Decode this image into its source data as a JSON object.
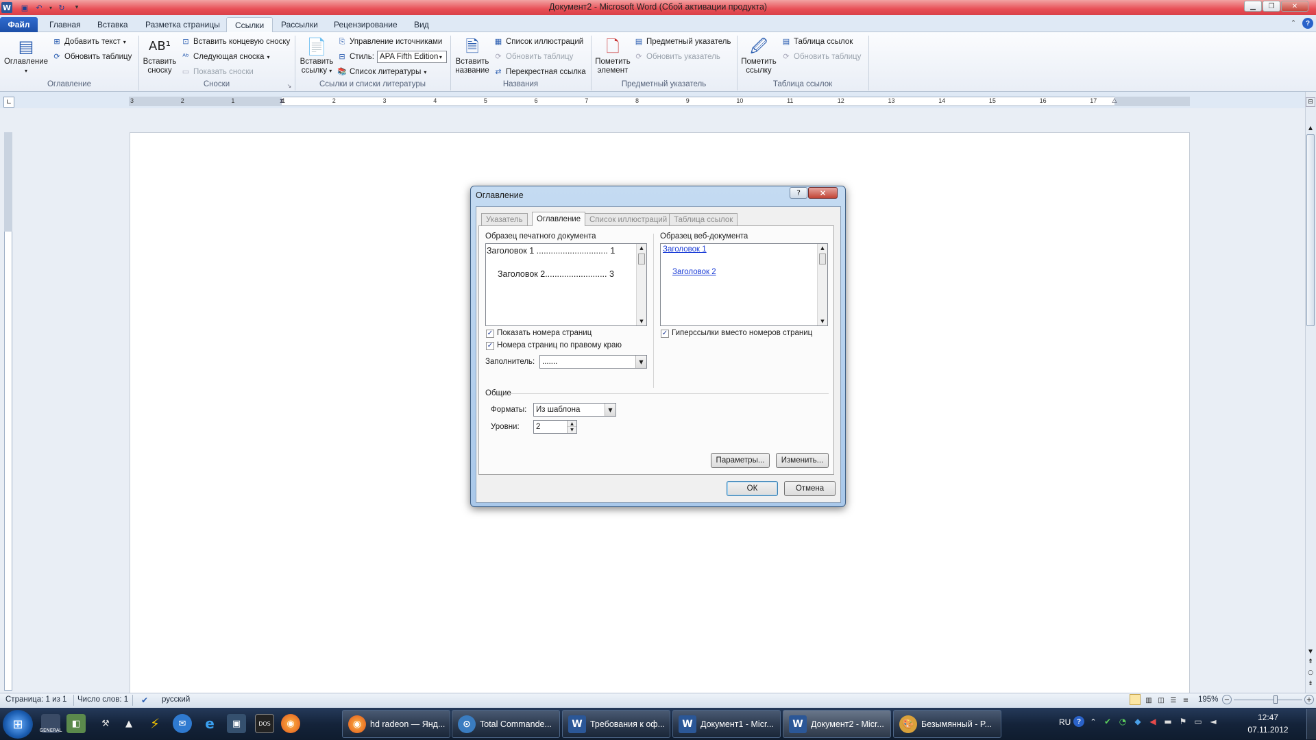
{
  "window": {
    "title": "Документ2 - Microsoft Word (Сбой активации продукта)"
  },
  "tabs": [
    {
      "label": "Файл"
    },
    {
      "label": "Главная"
    },
    {
      "label": "Вставка"
    },
    {
      "label": "Разметка страницы"
    },
    {
      "label": "Ссылки"
    },
    {
      "label": "Рассылки"
    },
    {
      "label": "Рецензирование"
    },
    {
      "label": "Вид"
    }
  ],
  "ribbon": {
    "toc": {
      "big": "Оглавление",
      "add_text": "Добавить текст",
      "update_table": "Обновить таблицу",
      "group": "Оглавление"
    },
    "footnotes": {
      "big_l1": "Вставить",
      "big_l2": "сноску",
      "endnote": "Вставить концевую сноску",
      "next": "Следующая сноска",
      "show": "Показать сноски",
      "group": "Сноски"
    },
    "citations": {
      "big_l1": "Вставить",
      "big_l2": "ссылку",
      "manage": "Управление источниками",
      "style_label": "Стиль:",
      "style_value": "APA Fifth Edition",
      "bibliography": "Список литературы",
      "group": "Ссылки и списки литературы"
    },
    "captions": {
      "big_l1": "Вставить",
      "big_l2": "название",
      "figures": "Список иллюстраций",
      "update": "Обновить таблицу",
      "cross": "Перекрестная ссылка",
      "group": "Названия"
    },
    "index": {
      "big_l1": "Пометить",
      "big_l2": "элемент",
      "insert": "Предметный указатель",
      "update": "Обновить указатель",
      "group": "Предметный указатель"
    },
    "authorities": {
      "big_l1": "Пометить",
      "big_l2": "ссылку",
      "insert": "Таблица ссылок",
      "update": "Обновить таблицу",
      "group": "Таблица ссылок"
    }
  },
  "ruler": {
    "labels": [
      "3",
      "2",
      "1",
      "1",
      "2",
      "3",
      "4",
      "5",
      "6",
      "7",
      "8",
      "9",
      "10",
      "11",
      "12",
      "13",
      "14",
      "15",
      "16",
      "17"
    ]
  },
  "dialog": {
    "title": "Оглавление",
    "tabs": [
      "Указатель",
      "Оглавление",
      "Список иллюстраций",
      "Таблица ссылок"
    ],
    "print_label": "Образец печатного документа",
    "print_h1": "Заголовок 1 .............................. 1",
    "print_h2": "Заголовок 2.......................... 3",
    "web_label": "Образец веб-документа",
    "web_h1": "Заголовок 1",
    "web_h2": "Заголовок 2",
    "show_numbers": "Показать номера страниц",
    "right_align": "Номера страниц по правому краю",
    "hyperlinks": "Гиперссылки вместо номеров страниц",
    "leader_label": "Заполнитель:",
    "leader_value": ".......",
    "general": "Общие",
    "formats_label": "Форматы:",
    "formats_value": "Из шаблона",
    "levels_label": "Уровни:",
    "levels_value": "2",
    "options": "Параметры...",
    "modify": "Изменить...",
    "ok": "ОК",
    "cancel": "Отмена"
  },
  "status": {
    "page": "Страница: 1 из 1",
    "words": "Число слов: 1",
    "language": "русский",
    "zoom": "195%"
  },
  "taskbar": {
    "items": [
      {
        "label": "hd radeon — Янд..."
      },
      {
        "label": "Total Commande..."
      },
      {
        "label": "Требования к оф..."
      },
      {
        "label": "Документ1 - Micr..."
      },
      {
        "label": "Документ2 - Micr..."
      },
      {
        "label": "Безымянный - P..."
      }
    ],
    "lang": "RU",
    "time": "12:47",
    "date": "07.11.2012",
    "general_label": "GENERAL",
    "dos_label": "DOS"
  },
  "icons": {
    "word": "word-icon",
    "save": "save-icon",
    "undo": "undo-icon",
    "redo": "redo-icon",
    "help": "help-icon",
    "start": "windows-start-icon"
  },
  "colors": {
    "titlebar": "#e84f56",
    "file_tab": "#2f6bd0",
    "hyperlink": "#1a3cd6"
  }
}
